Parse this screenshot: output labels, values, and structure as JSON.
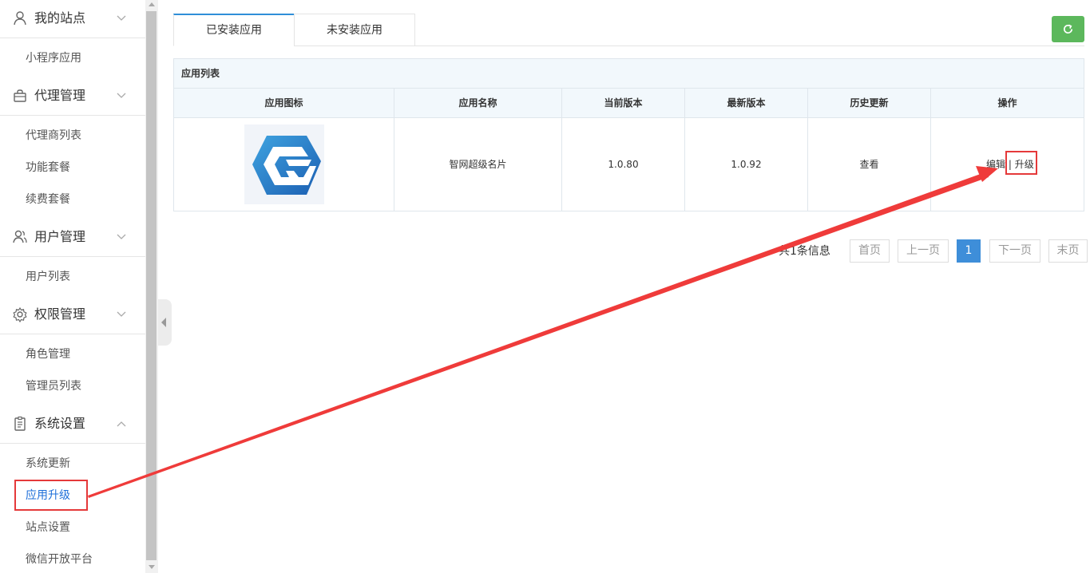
{
  "sidebar": {
    "groups": [
      {
        "title": "我的站点",
        "icon": "user-icon",
        "expanded": false,
        "items": [
          "小程序应用"
        ]
      },
      {
        "title": "代理管理",
        "icon": "bag-icon",
        "expanded": false,
        "items": [
          "代理商列表",
          "功能套餐",
          "续费套餐"
        ]
      },
      {
        "title": "用户管理",
        "icon": "users-icon",
        "expanded": false,
        "items": [
          "用户列表"
        ]
      },
      {
        "title": "权限管理",
        "icon": "gear-icon",
        "expanded": false,
        "items": [
          "角色管理",
          "管理员列表"
        ]
      },
      {
        "title": "系统设置",
        "icon": "clipboard-icon",
        "expanded": true,
        "items": [
          "系统更新",
          "应用升级",
          "站点设置",
          "微信开放平台"
        ]
      }
    ],
    "active_item": "应用升级"
  },
  "tabs": [
    {
      "label": "已安装应用",
      "active": true
    },
    {
      "label": "未安装应用",
      "active": false
    }
  ],
  "refresh_icon": "refresh-icon",
  "panel": {
    "title": "应用列表",
    "columns": [
      "应用图标",
      "应用名称",
      "当前版本",
      "最新版本",
      "历史更新",
      "操作"
    ],
    "rows": [
      {
        "icon": "app-logo-icon",
        "name": "智网超级名片",
        "current_version": "1.0.80",
        "latest_version": "1.0.92",
        "history": "查看",
        "edit": "编辑",
        "separator": "|",
        "upgrade": "升级"
      }
    ]
  },
  "pagination": {
    "info": "共1条信息",
    "first": "首页",
    "prev": "上一页",
    "current": "1",
    "next": "下一页",
    "last": "末页"
  },
  "colors": {
    "accent": "#2f8fd8",
    "refresh_button": "#5cb85c",
    "page_current": "#3e8ed9",
    "annotation": "#e5393a"
  }
}
